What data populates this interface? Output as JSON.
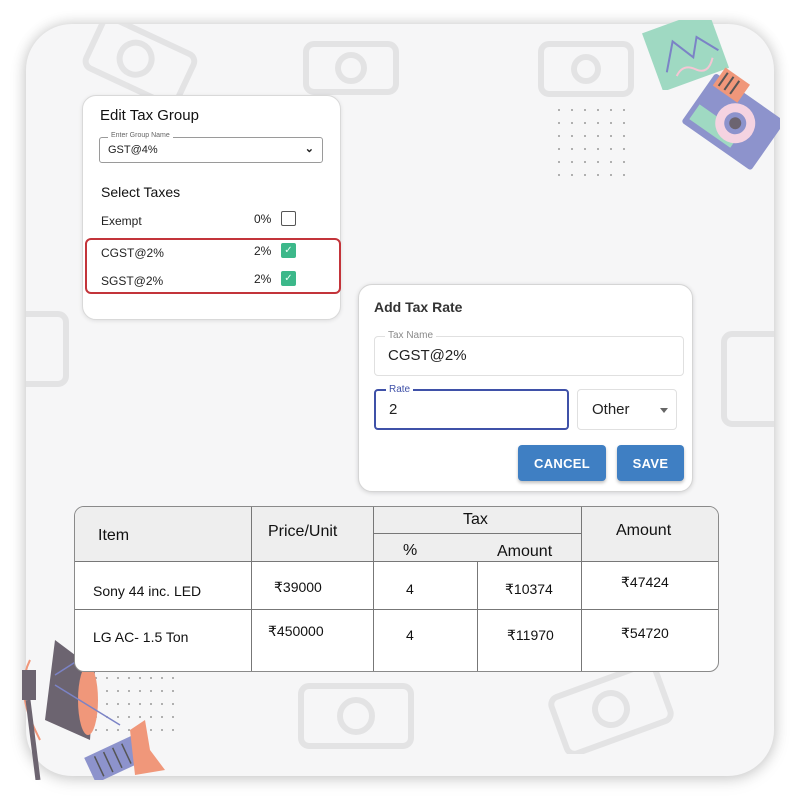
{
  "edit_tax_group": {
    "title": "Edit Tax Group",
    "group_name_label": "Enter Group Name",
    "group_name_value": "GST@4%",
    "select_taxes_heading": "Select Taxes",
    "taxes": [
      {
        "name": "Exempt",
        "rate": "0%",
        "checked": false
      },
      {
        "name": "CGST@2%",
        "rate": "2%",
        "checked": true
      },
      {
        "name": "SGST@2%",
        "rate": "2%",
        "checked": true
      }
    ],
    "check_glyph": "✓",
    "dropdown_icon": "chevron-down-icon",
    "checkbox_color": "#3cb88a",
    "highlight_color": "#c3343a"
  },
  "add_tax_rate": {
    "title": "Add Tax Rate",
    "tax_name_label": "Tax Name",
    "tax_name_value": "CGST@2%",
    "rate_label": "Rate",
    "rate_value": "2",
    "type_value": "Other",
    "cancel_label": "CANCEL",
    "save_label": "SAVE",
    "button_color": "#3f7fc3",
    "focus_color": "#3f51a8"
  },
  "table": {
    "headers": {
      "item": "Item",
      "price": "Price/Unit",
      "tax": "Tax",
      "tax_pct": "%",
      "tax_amount": "Amount",
      "amount": "Amount"
    },
    "rows": [
      {
        "item": "Sony 44 inc. LED",
        "price": "₹39000",
        "tax_pct": "4",
        "tax_amount": "₹10374",
        "amount": "₹47424"
      },
      {
        "item": "LG AC- 1.5 Ton",
        "price": "₹450000",
        "tax_pct": "4",
        "tax_amount": "₹11970",
        "amount": "₹54720"
      }
    ]
  }
}
